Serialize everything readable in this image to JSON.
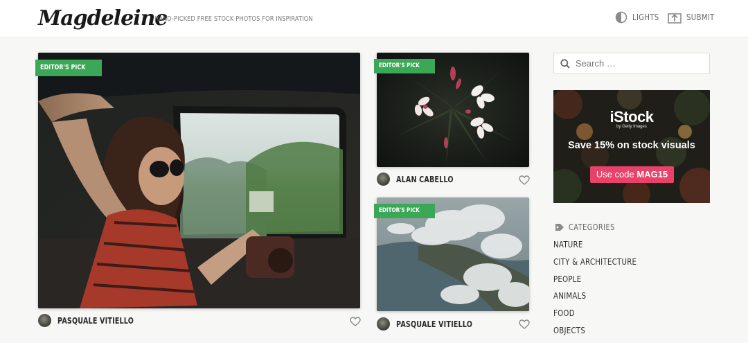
{
  "header": {
    "logo": "Magdeleine",
    "tagline": "HAND-PICKED FREE STOCK PHOTOS FOR INSPIRATION",
    "nav": [
      {
        "label": "LIGHTS",
        "icon": "lights-toggle-icon"
      },
      {
        "label": "SUBMIT",
        "icon": "upload-icon"
      }
    ]
  },
  "photos": [
    {
      "badge": "EDITOR'S PICK",
      "author": "PASQUALE VITIELLO",
      "subject": "woman in car window"
    },
    {
      "badge": "EDITOR'S PICK",
      "author": "ALAN CABELLO",
      "subject": "pink flowers dark"
    },
    {
      "badge": "EDITOR'S PICK",
      "author": "PASQUALE VITIELLO",
      "subject": "aerial clouds coast"
    }
  ],
  "sidebar": {
    "search_placeholder": "Search …",
    "ad": {
      "brand": "iStock",
      "sub": "by Getty Images",
      "headline": "Save 15% on stock visuals",
      "cta_prefix": "Use code ",
      "cta_code": "MAG15"
    },
    "categories_title": "CATEGORIES",
    "categories": [
      "NATURE",
      "CITY & ARCHITECTURE",
      "PEOPLE",
      "ANIMALS",
      "FOOD",
      "OBJECTS"
    ]
  },
  "colors": {
    "badge_green": "#3aa856",
    "ad_cta_pink": "#e8416a",
    "background": "#f7f7f5"
  }
}
